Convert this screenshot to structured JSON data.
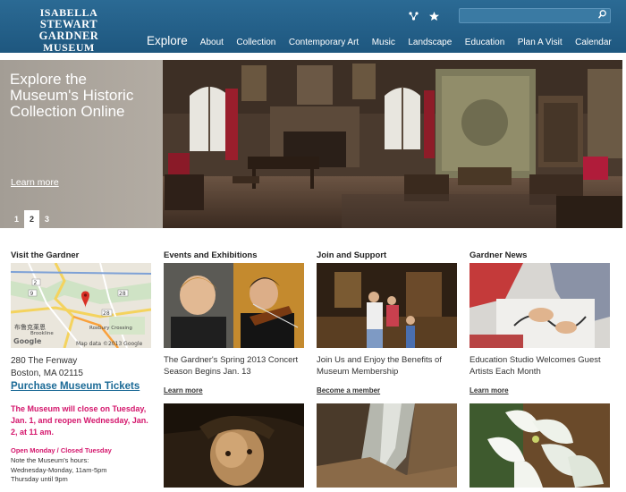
{
  "header": {
    "logo": {
      "line1": "ISABELLA",
      "line2": "STEWART GARDNER",
      "line3": "MUSEUM"
    },
    "icons": [
      "share-icon",
      "star-icon"
    ],
    "search": {
      "placeholder": "",
      "value": ""
    },
    "nav": [
      "Explore",
      "About",
      "Collection",
      "Contemporary Art",
      "Music",
      "Landscape",
      "Education",
      "Plan A Visit",
      "Calendar"
    ]
  },
  "hero": {
    "title": "Explore the Museum's Historic Collection Online",
    "link": "Learn more",
    "pages": [
      "1",
      "2",
      "3"
    ],
    "active_page": "2"
  },
  "visit": {
    "heading": "Visit the Gardner",
    "map": {
      "label_chinese": "布鲁克莱恩",
      "brookline": "Brookline",
      "roxbury": "Roxbury Crossing",
      "credit": "Map data ©2013 Google",
      "google": "Google",
      "routes": [
        "2",
        "9",
        "28",
        "28"
      ]
    },
    "address_line1": "280 The Fenway",
    "address_line2": "Boston, MA 02115",
    "tickets": "Purchase Museum Tickets",
    "notice": "The Museum will close on Tuesday, Jan. 1, and reopen Wednesday, Jan. 2, at 11 am.",
    "hours_title": "Open Monday / Closed Tuesday",
    "hours_line1": "Note the Museum's hours:",
    "hours_line2": "Wednesday-Monday, 11am-5pm",
    "hours_line3": "Thursday until 9pm"
  },
  "events": {
    "heading": "Events and Exhibitions",
    "text": "The Gardner's Spring 2013 Concert Season Begins Jan. 13",
    "link": "Learn more"
  },
  "join": {
    "heading": "Join and Support",
    "text": "Join Us and Enjoy the Benefits of Museum Membership",
    "link": "Become a member"
  },
  "news": {
    "heading": "Gardner News",
    "text": "Education Studio Welcomes Guest Artists Each Month",
    "link": "Learn more"
  }
}
